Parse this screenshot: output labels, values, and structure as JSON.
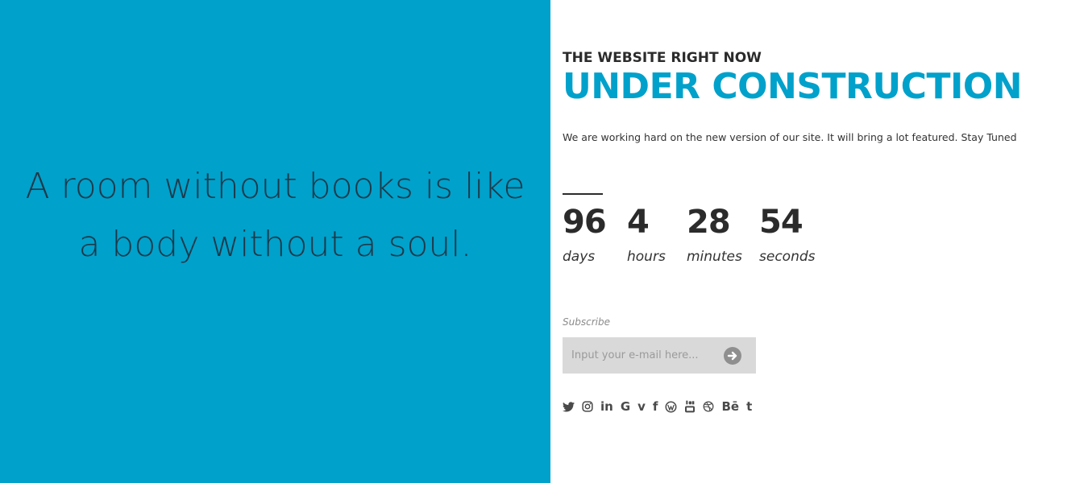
{
  "quote": {
    "line1": "A room without books is like",
    "line2": "a body without a soul."
  },
  "header": {
    "kicker": "THE WEBSITE RIGHT NOW",
    "headline": "UNDER CONSTRUCTION",
    "description": "We are working hard on the new version of our site. It will bring a lot featured. Stay Tuned"
  },
  "countdown": {
    "days": {
      "value": "96",
      "label": "days"
    },
    "hours": {
      "value": "4",
      "label": "hours"
    },
    "minutes": {
      "value": "28",
      "label": "minutes"
    },
    "seconds": {
      "value": "54",
      "label": "seconds"
    }
  },
  "subscribe": {
    "label": "Subscribe",
    "placeholder": "Input your e-mail here...",
    "value": ""
  },
  "social": {
    "icons": [
      "twitter-icon",
      "instagram-icon",
      "linkedin-icon",
      "google-icon",
      "vimeo-icon",
      "facebook-icon",
      "wordpress-icon",
      "youtube-icon",
      "dribbble-icon",
      "behance-icon",
      "tumblr-icon"
    ],
    "linkedin_text": "in",
    "google_text": "G",
    "vimeo_text": "v",
    "facebook_text": "f",
    "behance_text": "Bē",
    "tumblr_text": "t"
  },
  "colors": {
    "accent": "#00a1cb",
    "text_dark": "#2b2b2b",
    "input_bg": "#d9d9d9"
  }
}
